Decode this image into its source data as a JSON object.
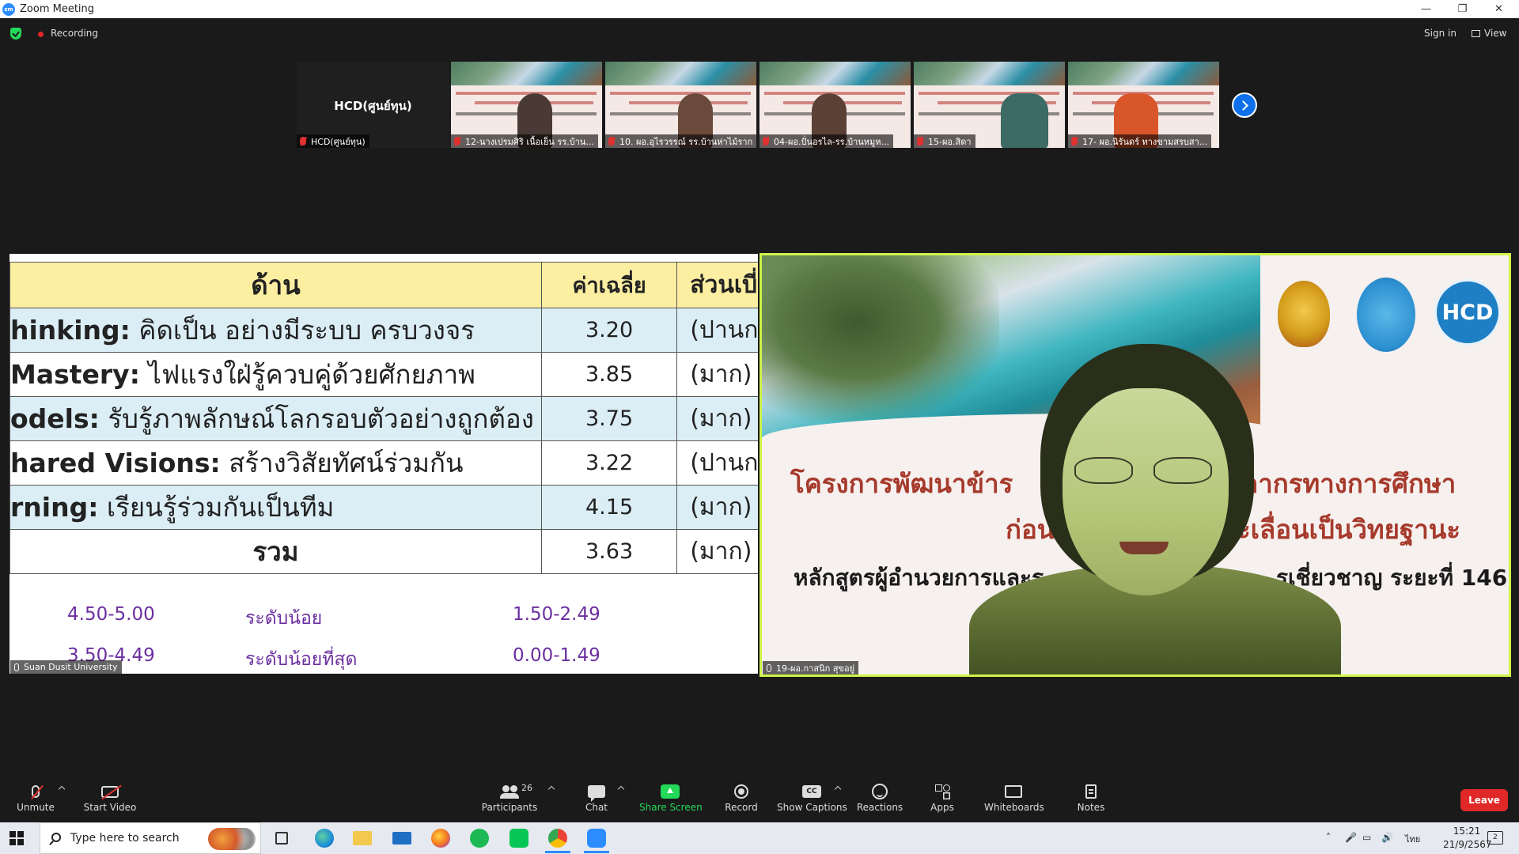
{
  "window": {
    "title": "Zoom Meeting",
    "app_icon": "zm"
  },
  "window_controls": {
    "minimize": "—",
    "restore": "❐",
    "close": "✕"
  },
  "topbar": {
    "recording_label": "Recording",
    "signin_label": "Sign in",
    "view_label": "View"
  },
  "gallery": {
    "self_tile": {
      "display_name": "HCD(ศูนย์ทุน)",
      "label": "HCD(ศูนย์ทุน)"
    },
    "tiles": [
      {
        "label": "12-นางเปรมศิริ เนื้อเย็น รร.บ้าน..."
      },
      {
        "label": "10. ผอ.อุไรวรรณ์ รร.บ้านห่าไม้ราก"
      },
      {
        "label": "04-ผอ.ปั่นอรไล-รร.บ้านหมูห..."
      },
      {
        "label": "15-ผอ.สิดา"
      },
      {
        "label": "17- ผอ.นิรันดร์ ทางขามสรบสา..."
      }
    ]
  },
  "share": {
    "owner_label": "Suan Dusit University",
    "headers": [
      "ด้าน",
      "ค่าเฉลี่ย",
      "ส่วนเบี่"
    ],
    "rows": [
      {
        "title": "hinking:",
        "desc": " คิดเป็น อย่างมีระบบ ครบวงจร",
        "mean": "3.20",
        "level": "(ปานก"
      },
      {
        "title": "Mastery:",
        "desc": " ไฟแรงใฝ่รู้ควบคู่ด้วยศักยภาพ",
        "mean": "3.85",
        "level": "(มาก)"
      },
      {
        "title": "odels:",
        "desc": " รับรู้ภาพลักษณ์โลกรอบตัวอย่างถูกต้อง",
        "mean": "3.75",
        "level": "(มาก)"
      },
      {
        "title": "hared Visions:",
        "desc": " สร้างวิสัยทัศน์ร่วมกัน",
        "mean": "3.22",
        "level": "(ปานก"
      },
      {
        "title": "rning:",
        "desc": " เรียนรู้ร่วมกันเป็นทีม",
        "mean": "4.15",
        "level": "(มาก)"
      },
      {
        "title": "",
        "desc": "รวม",
        "mean": "3.63",
        "level": "(มาก)"
      }
    ],
    "legend": [
      {
        "range_a": "4.50-5.00",
        "label": "ระดับน้อย",
        "range_b": "1.50-2.49"
      },
      {
        "range_a": "3.50-4.49",
        "label": "ระดับน้อยที่สุด",
        "range_b": "0.00-1.49"
      }
    ]
  },
  "speaker": {
    "label": "19-ผอ.กาสนิก สุขอยู่",
    "logo_text": "HCD",
    "banner_line1_a": "โครงการพัฒนาข้าร",
    "banner_line1_b": "ลากรทางการศึกษา",
    "banner_line2_a": "ก่อน",
    "banner_line2_b": "ะเลื่อนเป็นวิทยฐานะ",
    "banner_line3_a": "หลักสูตรผู้อำนวยการและร",
    "banner_line3_b": "รเชี่ยวชาญ ระยะที่ 146"
  },
  "toolbar": {
    "unmute": "Unmute",
    "start_video": "Start Video",
    "participants": "Participants",
    "participants_count": "26",
    "chat": "Chat",
    "share_screen": "Share Screen",
    "record": "Record",
    "show_captions": "Show Captions",
    "captions_icon_text": "CC",
    "reactions": "Reactions",
    "apps": "Apps",
    "whiteboards": "Whiteboards",
    "notes": "Notes",
    "leave": "Leave"
  },
  "taskbar": {
    "search_placeholder": "Type here to search",
    "language": "ไทย",
    "time": "15:21",
    "date": "21/9/2567",
    "notification_count": "2"
  },
  "colors": {
    "accent": "#0e71eb",
    "share_green": "#23d959",
    "leave_red": "#e02828",
    "active_speaker_border": "#cff24a",
    "table_header": "#fcefa2",
    "table_row_blue": "#dbeef6",
    "legend_purple": "#6b2fa0"
  }
}
